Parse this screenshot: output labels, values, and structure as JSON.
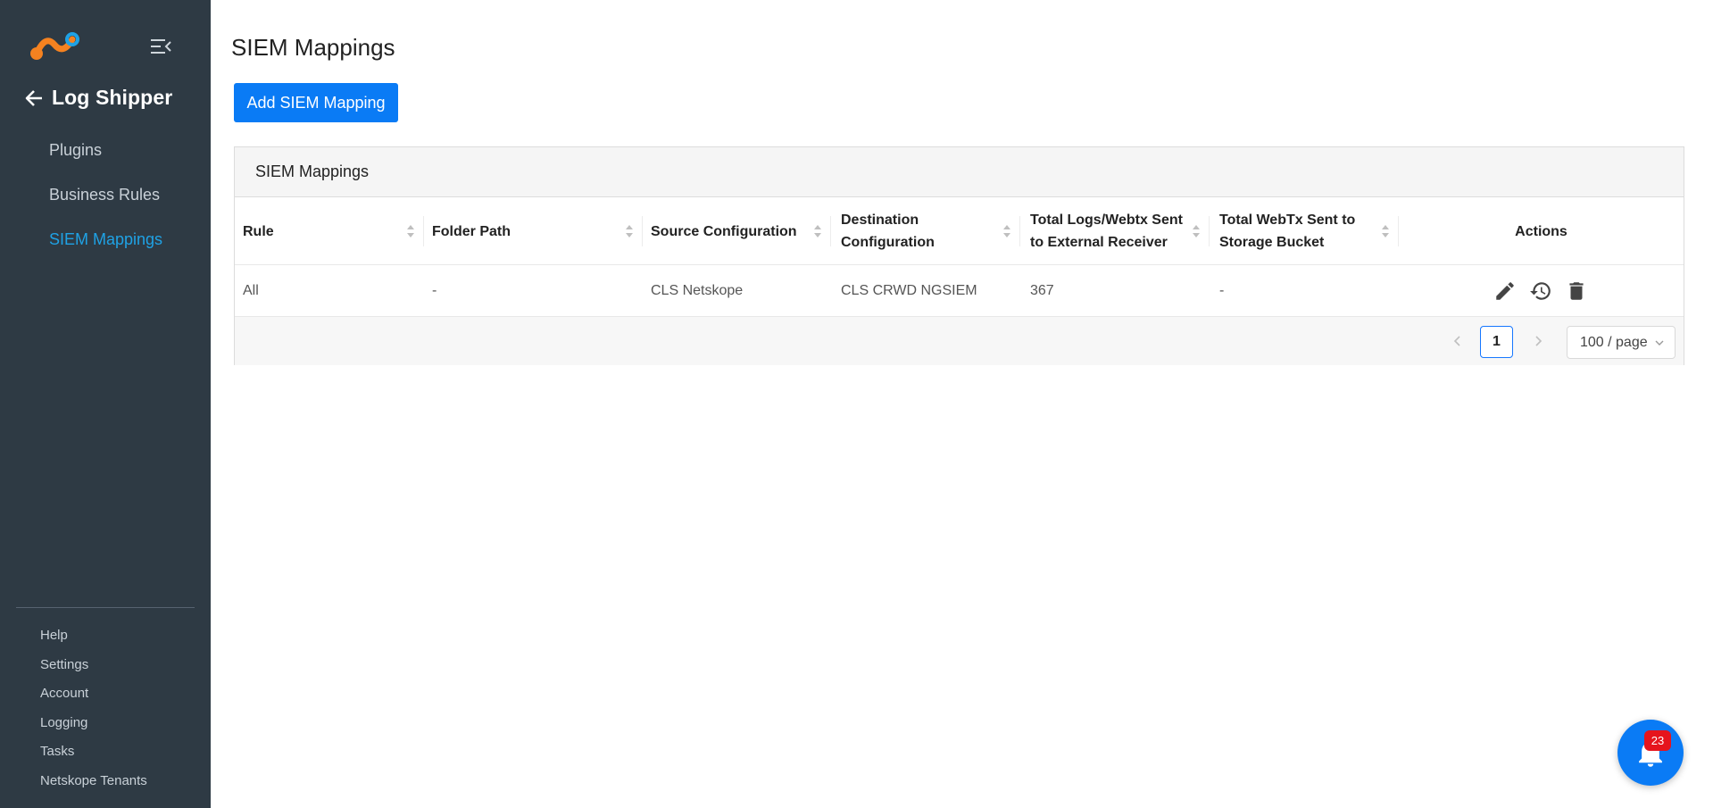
{
  "sidebar": {
    "back_title": "Log Shipper",
    "nav": [
      {
        "label": "Plugins",
        "active": false
      },
      {
        "label": "Business Rules",
        "active": false
      },
      {
        "label": "SIEM Mappings",
        "active": true
      }
    ],
    "bottom": [
      {
        "label": "Help"
      },
      {
        "label": "Settings"
      },
      {
        "label": "Account"
      },
      {
        "label": "Logging"
      },
      {
        "label": "Tasks"
      },
      {
        "label": "Netskope Tenants"
      }
    ]
  },
  "main": {
    "page_title": "SIEM Mappings",
    "add_button": "Add SIEM Mapping",
    "card_title": "SIEM Mappings",
    "columns": [
      {
        "label": "Rule",
        "sortable": true
      },
      {
        "label": "Folder Path",
        "sortable": true
      },
      {
        "label": "Source Configuration",
        "sortable": true
      },
      {
        "label": "Destination Configuration",
        "sortable": true
      },
      {
        "label": "Total Logs/Webtx Sent to External Receiver",
        "sortable": true
      },
      {
        "label": "Total WebTx Sent to Storage Bucket",
        "sortable": true
      },
      {
        "label": "Actions",
        "sortable": false
      }
    ],
    "rows": [
      {
        "rule": "All",
        "folder_path": "-",
        "source": "CLS Netskope",
        "destination": "CLS CRWD NGSIEM",
        "total_logs": "367",
        "total_webtx": "-",
        "actions": [
          "edit-icon",
          "history-icon",
          "delete-icon"
        ]
      }
    ],
    "pagination": {
      "current_page": "1",
      "page_size": "100 / page"
    }
  },
  "notifications": {
    "badge_count": "23"
  },
  "colors": {
    "sidebar_bg": "#2e3a44",
    "accent": "#0a7bf5",
    "active_nav": "#1fa2e5",
    "badge": "#e6141c"
  }
}
